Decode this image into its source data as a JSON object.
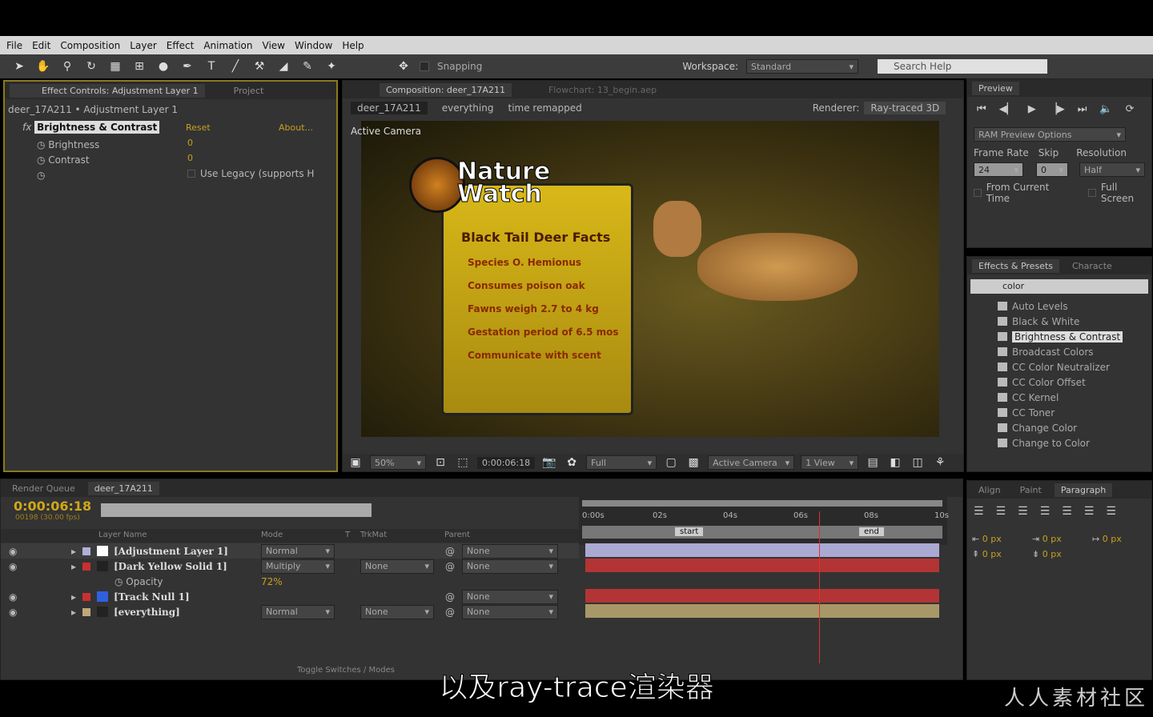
{
  "menu": [
    "File",
    "Edit",
    "Composition",
    "Layer",
    "Effect",
    "Animation",
    "View",
    "Window",
    "Help"
  ],
  "toolbar": {
    "snapping": "Snapping",
    "workspace_label": "Workspace:",
    "workspace": "Standard",
    "search_placeholder": "Search Help"
  },
  "effect_controls": {
    "tab": "Effect Controls: Adjustment Layer 1",
    "tab2": "Project",
    "breadcrumb": "deer_17A211 • Adjustment Layer 1",
    "effect": "Brightness & Contrast",
    "reset": "Reset",
    "about": "About...",
    "props": [
      "Brightness",
      "Contrast"
    ],
    "brightness_value": "0",
    "contrast_value": "0",
    "legacy": "Use Legacy (supports H"
  },
  "composition": {
    "tab": "Composition: deer_17A211",
    "tab2": "Flowchart: 13_begin.aep",
    "crumbs": [
      "deer_17A211",
      "everything",
      "time remapped"
    ],
    "renderer_label": "Renderer:",
    "renderer": "Ray-traced 3D",
    "active_camera": "Active Camera",
    "sign": {
      "logo1": "Nature",
      "logo2": "Watch",
      "title": "Black Tail Deer Facts",
      "facts": [
        "Species O. Hemionus",
        "Consumes poison oak",
        "Fawns weigh 2.7 to 4 kg",
        "Gestation period of 6.5 mos",
        "Communicate with scent"
      ]
    },
    "footer": {
      "zoom": "50%",
      "timecode": "0:00:06:18",
      "resolution": "Full",
      "camera": "Active Camera",
      "views": "1 View"
    }
  },
  "preview": {
    "tab": "Preview",
    "ram": "RAM Preview Options",
    "frame_rate_label": "Frame Rate",
    "skip_label": "Skip",
    "resolution_label": "Resolution",
    "frame_rate": "24",
    "skip": "0",
    "resolution": "Half",
    "from_current": "From Current Time",
    "full_screen": "Full Screen"
  },
  "effects_presets": {
    "tab": "Effects & Presets",
    "tab2": "Characte",
    "search": "color",
    "items": [
      "Auto Levels",
      "Black & White",
      "Brightness & Contrast",
      "Broadcast Colors",
      "CC Color Neutralizer",
      "CC Color Offset",
      "CC Kernel",
      "CC Toner",
      "Change Color",
      "Change to Color"
    ],
    "selected": 2
  },
  "timeline": {
    "tab1": "Render Queue",
    "tab2": "deer_17A211",
    "timecode": "0:00:06:18",
    "frames": "00198 (30.00 fps)",
    "headers": {
      "name": "Layer Name",
      "mode": "Mode",
      "t": "T",
      "trkmat": "TrkMat",
      "parent": "Parent"
    },
    "layers": [
      {
        "name": "[Adjustment Layer 1]",
        "mode": "Normal",
        "trkmat": "",
        "parent": "None",
        "label": "#b0b0d8",
        "bar": "#a9a9d2"
      },
      {
        "name": "[Dark Yellow Solid 1]",
        "mode": "Multiply",
        "trkmat": "None",
        "parent": "None",
        "label": "#c83030",
        "bar": "#b33434"
      },
      {
        "name": "[Track Null 1]",
        "mode": "",
        "trkmat": "",
        "parent": "None",
        "label": "#c83030",
        "bar": "#b33434"
      },
      {
        "name": "[everything]",
        "mode": "Normal",
        "trkmat": "None",
        "parent": "None",
        "label": "#c0a878",
        "bar": "#a89868"
      }
    ],
    "opacity_label": "Opacity",
    "opacity_value": "72%",
    "ruler": [
      "0:00s",
      "02s",
      "04s",
      "06s",
      "08s",
      "10s"
    ],
    "marker_start": "start",
    "marker_end": "end",
    "toggle": "Toggle Switches / Modes",
    "current_time_s": 6.6,
    "duration_s": 10
  },
  "paragraph": {
    "tabs": [
      "Align",
      "Paint",
      "Paragraph"
    ],
    "values": [
      "0 px",
      "0 px",
      "0 px",
      "0 px",
      "0 px"
    ]
  },
  "subtitle": "以及ray-trace渲染器",
  "watermark": "人人素材社区"
}
